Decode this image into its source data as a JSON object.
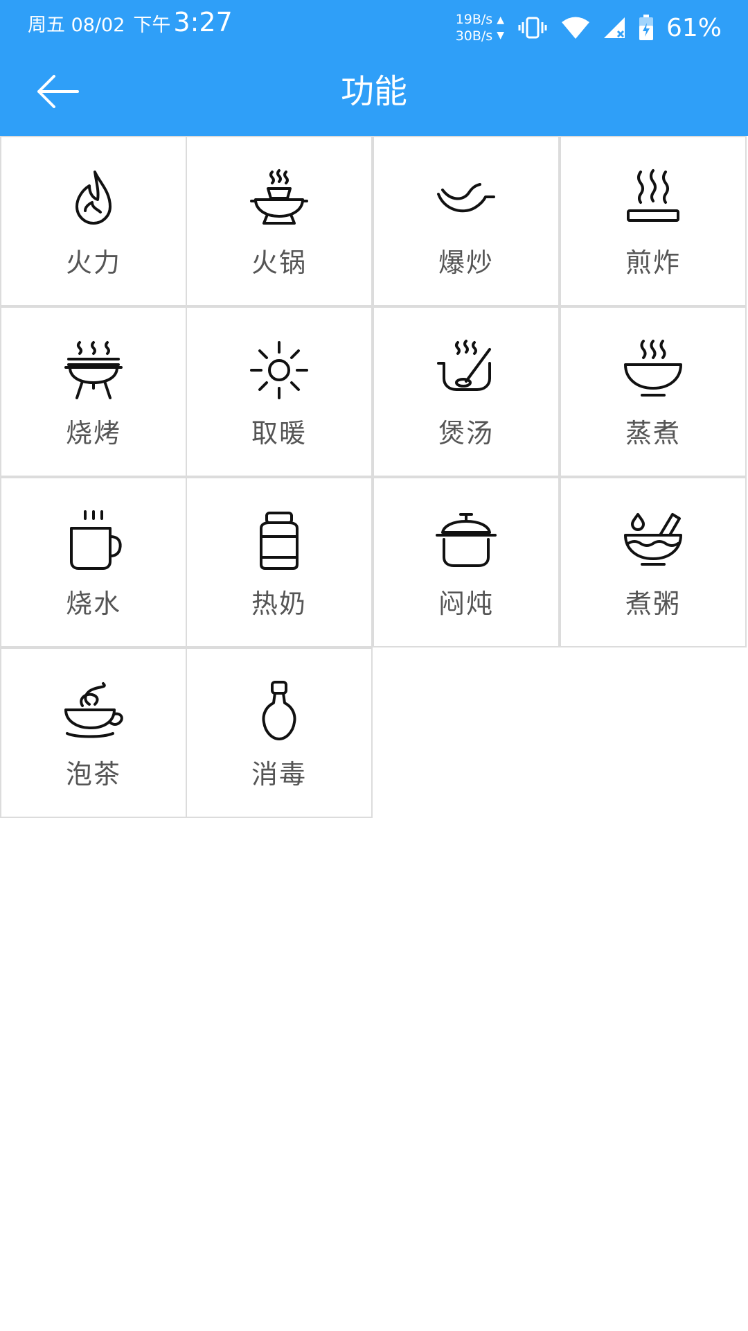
{
  "status_bar": {
    "date": "周五 08/02",
    "period": "下午",
    "time": "3:27",
    "net_up": "19B/s",
    "net_down": "30B/s",
    "battery": "61%"
  },
  "header": {
    "title": "功能"
  },
  "functions": [
    {
      "label": "火力",
      "icon": "flame-icon"
    },
    {
      "label": "火锅",
      "icon": "hotpot-icon"
    },
    {
      "label": "爆炒",
      "icon": "wok-icon"
    },
    {
      "label": "煎炸",
      "icon": "fry-pan-icon"
    },
    {
      "label": "烧烤",
      "icon": "grill-icon"
    },
    {
      "label": "取暖",
      "icon": "sun-icon"
    },
    {
      "label": "煲汤",
      "icon": "soup-icon"
    },
    {
      "label": "蒸煮",
      "icon": "steam-bowl-icon"
    },
    {
      "label": "烧水",
      "icon": "kettle-mug-icon"
    },
    {
      "label": "热奶",
      "icon": "milk-jar-icon"
    },
    {
      "label": "闷炖",
      "icon": "stew-pot-icon"
    },
    {
      "label": "煮粥",
      "icon": "porridge-bowl-icon"
    },
    {
      "label": "泡茶",
      "icon": "tea-cup-icon"
    },
    {
      "label": "消毒",
      "icon": "bulb-icon"
    }
  ],
  "colors": {
    "accent": "#2f9ff8",
    "grid_border": "#dcdcdc",
    "label": "#555555"
  }
}
